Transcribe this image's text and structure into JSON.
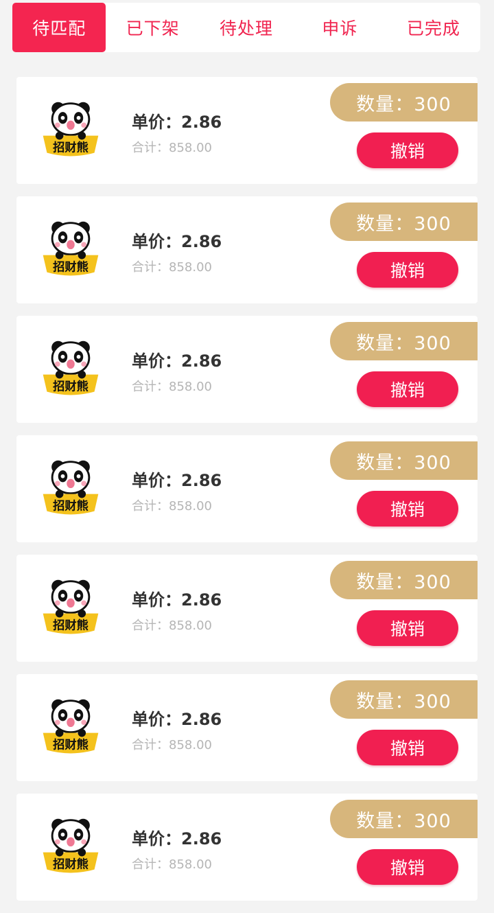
{
  "tabs": [
    {
      "label": "待匹配",
      "active": true
    },
    {
      "label": "已下架",
      "active": false
    },
    {
      "label": "待处理",
      "active": false
    },
    {
      "label": "申诉",
      "active": false
    },
    {
      "label": "已完成",
      "active": false
    }
  ],
  "logo_text": "招财熊",
  "orders": [
    {
      "price": "单价：2.86",
      "total": "合计：858.00",
      "quantity": "数量：300",
      "action": "撤销"
    },
    {
      "price": "单价：2.86",
      "total": "合计：858.00",
      "quantity": "数量：300",
      "action": "撤销"
    },
    {
      "price": "单价：2.86",
      "total": "合计：858.00",
      "quantity": "数量：300",
      "action": "撤销"
    },
    {
      "price": "单价：2.86",
      "total": "合计：858.00",
      "quantity": "数量：300",
      "action": "撤销"
    },
    {
      "price": "单价：2.86",
      "total": "合计：858.00",
      "quantity": "数量：300",
      "action": "撤销"
    },
    {
      "price": "单价：2.86",
      "total": "合计：858.00",
      "quantity": "数量：300",
      "action": "撤销"
    },
    {
      "price": "单价：2.86",
      "total": "合计：858.00",
      "quantity": "数量：300",
      "action": "撤销"
    }
  ],
  "colors": {
    "accent": "#f42550",
    "quantity_badge": "#d7b67c",
    "background": "#f3f3f3"
  }
}
